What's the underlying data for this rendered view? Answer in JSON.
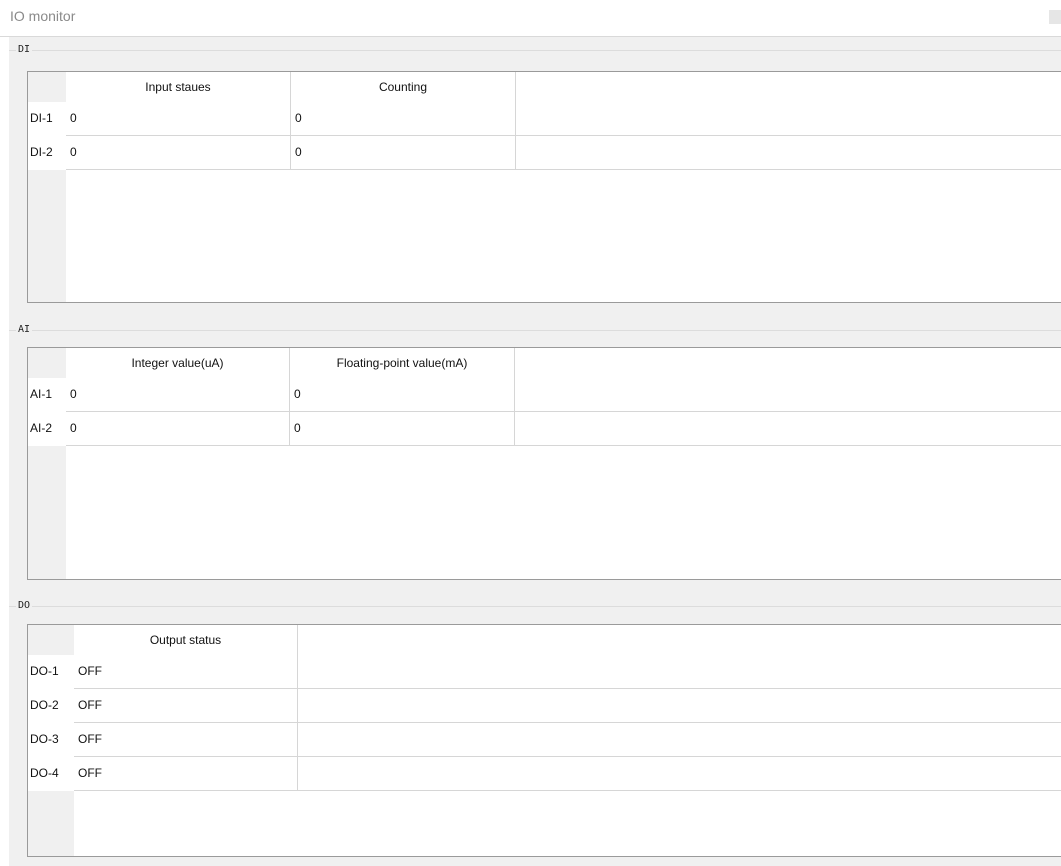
{
  "window": {
    "title": "IO monitor"
  },
  "groups": {
    "di": {
      "title": "DI",
      "columns": [
        "Input staues",
        "Counting"
      ],
      "rows": [
        {
          "label": "DI-1",
          "values": [
            "0",
            "0"
          ]
        },
        {
          "label": "DI-2",
          "values": [
            "0",
            "0"
          ]
        }
      ]
    },
    "ai": {
      "title": "AI",
      "columns": [
        "Integer value(uA)",
        "Floating-point value(mA)"
      ],
      "rows": [
        {
          "label": "AI-1",
          "values": [
            "0",
            "0"
          ]
        },
        {
          "label": "AI-2",
          "values": [
            "0",
            "0"
          ]
        }
      ]
    },
    "do": {
      "title": "DO",
      "columns": [
        "Output status"
      ],
      "rows": [
        {
          "label": "DO-1",
          "values": [
            "OFF"
          ]
        },
        {
          "label": "DO-2",
          "values": [
            "OFF"
          ]
        },
        {
          "label": "DO-3",
          "values": [
            "OFF"
          ]
        },
        {
          "label": "DO-4",
          "values": [
            "OFF"
          ]
        }
      ]
    }
  }
}
